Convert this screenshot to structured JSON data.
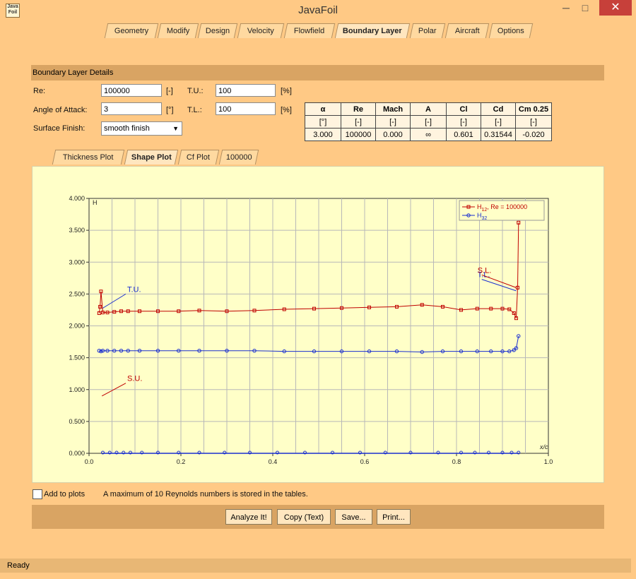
{
  "window": {
    "title": "JavaFoil",
    "icon_text": "Java Foil",
    "min_glyph": "─",
    "max_glyph": "□",
    "close_glyph": "✕"
  },
  "tabs": [
    "Geometry",
    "Modify",
    "Design",
    "Velocity",
    "Flowfield",
    "Boundary Layer",
    "Polar",
    "Aircraft",
    "Options"
  ],
  "active_tab": "Boundary Layer",
  "section_title": "Boundary Layer Details",
  "form": {
    "re_label": "Re:",
    "re_value": "100000",
    "re_unit": "[-]",
    "aoa_label": "Angle of Attack:",
    "aoa_value": "3",
    "aoa_unit": "[°]",
    "surface_label": "Surface Finish:",
    "surface_value": "smooth finish",
    "tu_label": "T.U.:",
    "tu_value": "100",
    "tu_unit": "[%]",
    "tl_label": "T.L.:",
    "tl_value": "100",
    "tl_unit": "[%]"
  },
  "results": {
    "headers": [
      "α",
      "Re",
      "Mach",
      "A",
      "Cl",
      "Cd",
      "Cm 0.25"
    ],
    "units": [
      "[°]",
      "[-]",
      "[-]",
      "[-]",
      "[-]",
      "[-]",
      "[-]"
    ],
    "values": [
      "3.000",
      "100000",
      "0.000",
      "∞",
      "0.601",
      "0.31544",
      "-0.020"
    ]
  },
  "sub_tabs": [
    "Thickness Plot",
    "Shape Plot",
    "Cf Plot",
    "100000"
  ],
  "active_sub_tab": "Shape Plot",
  "chart_data": {
    "type": "line",
    "xlabel": "x/c",
    "ylabel": "H",
    "xlim": [
      0,
      1.0
    ],
    "ylim": [
      0,
      4.0
    ],
    "xticks": [
      "0.0",
      "0.2",
      "0.4",
      "0.6",
      "0.8",
      "1.0"
    ],
    "yticks": [
      "0.000",
      "0.500",
      "1.000",
      "1.500",
      "2.000",
      "2.500",
      "3.000",
      "3.500",
      "4.000"
    ],
    "grid": true,
    "legend_position": "top-right",
    "legend": [
      {
        "main": "H",
        "sub": "12",
        "suffix": ", Re = 100000"
      },
      {
        "main": "H",
        "sub": "32",
        "suffix": ""
      }
    ],
    "series": [
      {
        "name": "H12, Re = 100000",
        "color": "#c00000",
        "marker": "square",
        "x": [
          0.022,
          0.024,
          0.026,
          0.03,
          0.04,
          0.055,
          0.07,
          0.085,
          0.11,
          0.15,
          0.195,
          0.24,
          0.3,
          0.36,
          0.425,
          0.49,
          0.55,
          0.61,
          0.67,
          0.725,
          0.77,
          0.81,
          0.845,
          0.875,
          0.9,
          0.915,
          0.925,
          0.93,
          0.933,
          0.935
        ],
        "y": [
          2.2,
          2.3,
          2.54,
          2.21,
          2.21,
          2.22,
          2.23,
          2.23,
          2.23,
          2.23,
          2.23,
          2.24,
          2.23,
          2.24,
          2.26,
          2.27,
          2.28,
          2.29,
          2.3,
          2.33,
          2.3,
          2.25,
          2.27,
          2.27,
          2.27,
          2.26,
          2.2,
          2.12,
          2.6,
          3.62
        ]
      },
      {
        "name": "H32",
        "color": "#1a2fd0",
        "marker": "circle",
        "x": [
          0.022,
          0.026,
          0.03,
          0.04,
          0.055,
          0.07,
          0.085,
          0.11,
          0.15,
          0.195,
          0.24,
          0.3,
          0.36,
          0.425,
          0.49,
          0.55,
          0.61,
          0.67,
          0.725,
          0.77,
          0.81,
          0.845,
          0.875,
          0.9,
          0.915,
          0.925,
          0.93,
          0.935
        ],
        "y": [
          1.61,
          1.6,
          1.61,
          1.61,
          1.61,
          1.61,
          1.61,
          1.61,
          1.61,
          1.61,
          1.61,
          1.61,
          1.61,
          1.6,
          1.6,
          1.6,
          1.6,
          1.6,
          1.59,
          1.6,
          1.6,
          1.6,
          1.6,
          1.6,
          1.6,
          1.62,
          1.65,
          1.84
        ]
      }
    ],
    "annotations": [
      {
        "text": "T.U.",
        "color": "#1a2fd0",
        "x": 0.08,
        "y": 2.5,
        "to_x": 0.028,
        "to_y": 2.27
      },
      {
        "text": "S.U.",
        "color": "#c00000",
        "x": 0.08,
        "y": 1.1,
        "to_x": 0.028,
        "to_y": 0.9
      },
      {
        "text": "T.L.",
        "color": "#1a2fd0",
        "x": 0.855,
        "y": 2.73,
        "to_x": 0.93,
        "to_y": 2.55
      },
      {
        "text": "S.L.",
        "color": "#c00000",
        "x": 0.855,
        "y": 2.8,
        "to_x": 0.93,
        "to_y": 2.6
      }
    ]
  },
  "add_to_plots_label": "Add to plots",
  "info_text": "A maximum of 10 Reynolds numbers is stored in the tables.",
  "buttons": {
    "analyze": "Analyze It!",
    "copy": "Copy (Text)",
    "save": "Save...",
    "print": "Print..."
  },
  "status": "Ready"
}
